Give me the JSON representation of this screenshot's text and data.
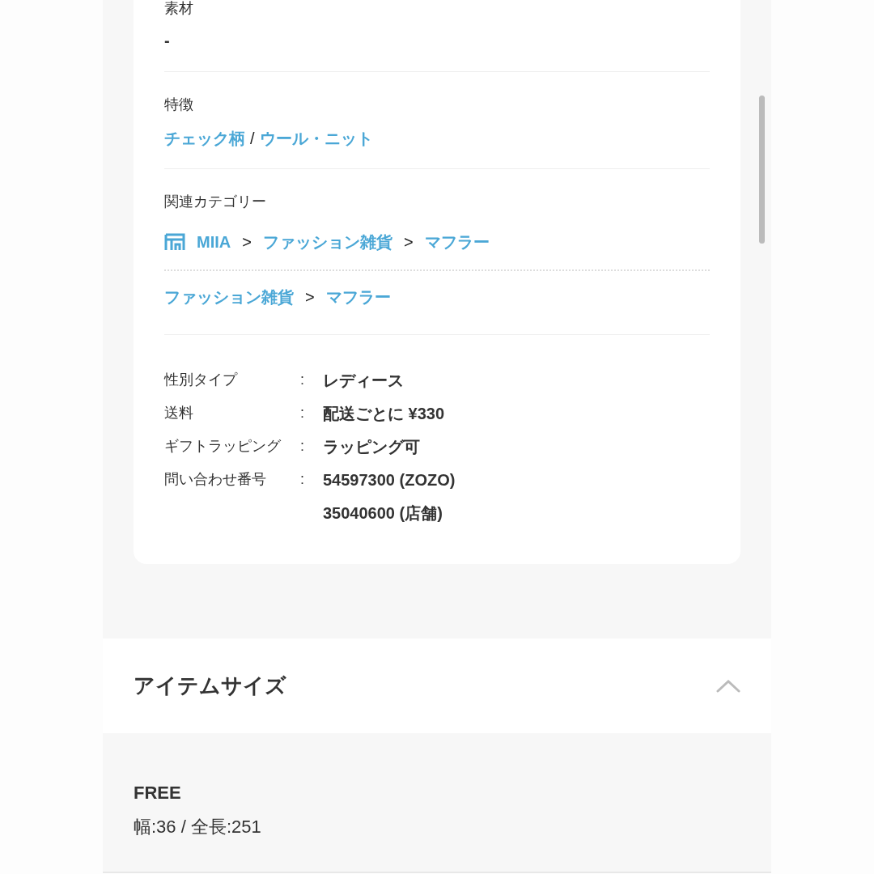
{
  "material": {
    "label": "素材",
    "value": "-"
  },
  "features": {
    "label": "特徴",
    "items": [
      {
        "kind": "link",
        "text": "チェック柄"
      },
      {
        "kind": "separator",
        "text": "/"
      },
      {
        "kind": "link",
        "text": "ウール・ニット"
      }
    ]
  },
  "related_categories": {
    "label": "関連カテゴリー",
    "paths": [
      {
        "kind": "shop",
        "items": [
          {
            "kind": "link",
            "text": "MIIA"
          },
          {
            "kind": "separator",
            "text": ">"
          },
          {
            "kind": "link",
            "text": "ファッション雑貨"
          },
          {
            "kind": "separator",
            "text": ">"
          },
          {
            "kind": "link",
            "text": "マフラー"
          }
        ]
      },
      {
        "kind": "category",
        "items": [
          {
            "kind": "link",
            "text": "ファッション雑貨"
          },
          {
            "kind": "separator",
            "text": ">"
          },
          {
            "kind": "link",
            "text": "マフラー"
          }
        ]
      }
    ]
  },
  "specs": [
    {
      "label": "性別タイプ",
      "colon": ":",
      "values": [
        "レディース"
      ]
    },
    {
      "label": "送料",
      "colon": ":",
      "values": [
        "配送ごとに ¥330"
      ]
    },
    {
      "label": "ギフトラッピング",
      "colon": ":",
      "values": [
        "ラッピング可"
      ]
    },
    {
      "label": "問い合わせ番号",
      "colon": ":",
      "values": [
        "54597300 (ZOZO)",
        "35040600 (店舗)"
      ]
    }
  ],
  "item_size": {
    "title": "アイテムサイズ",
    "expanded": true,
    "size": "FREE",
    "measurements": "幅:36 / 全長:251"
  }
}
